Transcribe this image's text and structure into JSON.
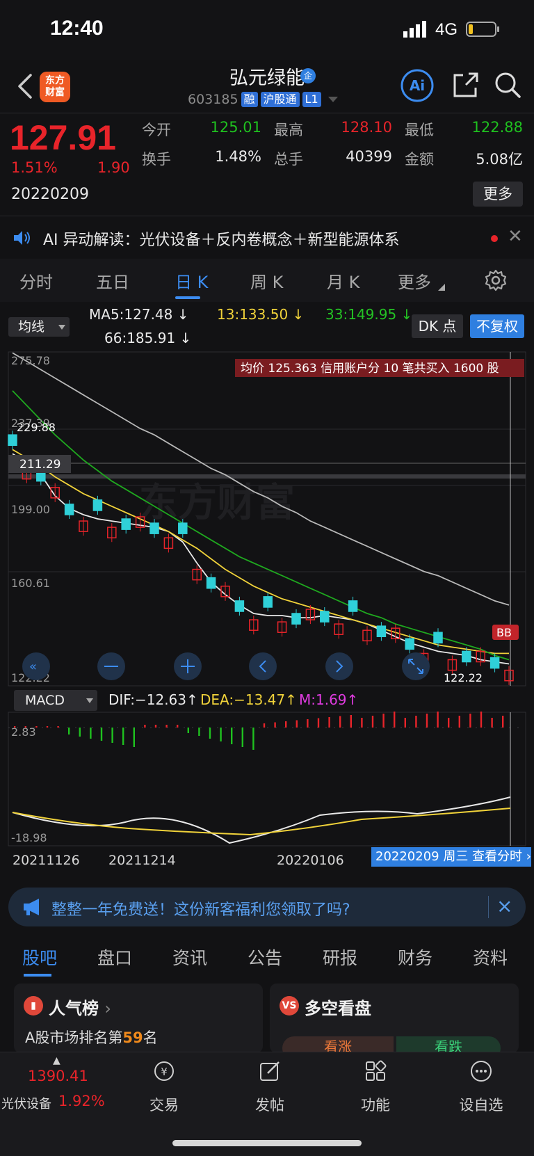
{
  "status_bar": {
    "time": "12:40",
    "network": "4G"
  },
  "header": {
    "logo_text": "东方\n财富",
    "stock_name": "弘元绿能",
    "corp_tag": "企",
    "code": "603185",
    "badges": [
      "融",
      "沪股通",
      "L1"
    ],
    "ai_label": "Ai"
  },
  "quote": {
    "price": "127.91",
    "change_pct": "1.51%",
    "change_abs": "1.90",
    "date": "20220209",
    "open_label": "今开",
    "open": "125.01",
    "high_label": "最高",
    "high": "128.10",
    "low_label": "最低",
    "low": "122.88",
    "turnover_label": "换手",
    "turnover": "1.48%",
    "volume_label": "总手",
    "volume": "40399",
    "amount_label": "金额",
    "amount": "5.08亿",
    "more_label": "更多"
  },
  "ai_bar": {
    "text": "AI 异动解读：光伏设备＋反内卷概念＋新型能源体系",
    "close": "✕"
  },
  "tabs": [
    "分时",
    "五日",
    "日 K",
    "周 K",
    "月 K",
    "更多"
  ],
  "ma": {
    "select_label": "均线",
    "ma5": "MA5:127.48",
    "ma13": "13:133.50",
    "ma33": "33:149.95",
    "ma66": "66:185.91",
    "dk_label": "DK 点",
    "fq_label": "不复权"
  },
  "kchart": {
    "info_banner": "均价 125.363 信用账户分 10 笔共买入 1600 股",
    "price_labels": [
      "275.78",
      "237.39",
      "199.00",
      "160.61",
      "122.22"
    ],
    "crosshair_price": "211.29",
    "high_marker": "229.88",
    "low_marker": "122.22",
    "bb_label": "BB"
  },
  "macd": {
    "select_label": "MACD",
    "dif": "DIF:−12.63",
    "dea": "DEA:−13.47",
    "m": "M:1.69",
    "top_label": "2.83",
    "bottom_label": "-18.98"
  },
  "date_axis": {
    "dates": [
      "20211126",
      "20211214",
      "20220106"
    ],
    "tip": "20220209 周三  查看分时"
  },
  "banner": {
    "text": "整整一年免费送！这份新客福利您领取了吗?"
  },
  "sub_tabs": [
    "股吧",
    "盘口",
    "资讯",
    "公告",
    "研报",
    "财务",
    "资料"
  ],
  "cards": {
    "popular_title": "人气榜",
    "rank_prefix": "A股市场排名第",
    "rank_num": "59",
    "rank_suffix": "名",
    "longshort_title": "多空看盘",
    "bull": "看涨",
    "bear": "看跌"
  },
  "bottom_nav": {
    "index_value": "1390.41",
    "index_name": "光伏设备",
    "index_pct": "1.92%",
    "items": [
      "交易",
      "发帖",
      "功能",
      "设自选"
    ]
  },
  "colors": {
    "up": "#e8242a",
    "down": "#1fc11f",
    "accent": "#3c8cf0",
    "candle_down": "#2fd0d8"
  },
  "chart_data": {
    "type": "candlestick",
    "ylim": [
      122.22,
      275.78
    ],
    "series": [
      {
        "name": "MA5",
        "values": [
          228,
          224,
          218,
          208,
          202,
          199,
          197,
          196,
          195,
          194,
          193,
          191,
          186,
          176,
          167,
          161,
          156,
          152,
          151,
          151,
          150,
          150,
          151,
          150,
          149,
          147,
          144,
          141,
          138,
          136,
          134,
          133,
          132,
          130,
          129,
          128
        ]
      },
      {
        "name": "MA13",
        "values": [
          230,
          226,
          222,
          217,
          213,
          209,
          206,
          203,
          200,
          197,
          194,
          191,
          187,
          183,
          178,
          173,
          169,
          165,
          162,
          159,
          157,
          155,
          153,
          151,
          149,
          147,
          145,
          143,
          141,
          139,
          137,
          136,
          135,
          134,
          133,
          133
        ]
      },
      {
        "name": "MA33",
        "values": [
          258,
          251,
          244,
          237,
          231,
          225,
          220,
          215,
          211,
          207,
          203,
          199,
          195,
          191,
          187,
          183,
          179,
          176,
          173,
          170,
          167,
          164,
          161,
          158,
          155,
          152,
          150,
          147,
          145,
          143,
          141,
          139,
          137,
          135,
          132,
          130
        ]
      },
      {
        "name": "MA66",
        "values": [
          276,
          272,
          268,
          264,
          260,
          256,
          252,
          248,
          244,
          240,
          237,
          233,
          229,
          225,
          221,
          218,
          214,
          210,
          207,
          203,
          200,
          196,
          193,
          190,
          187,
          184,
          181,
          178,
          175,
          172,
          170,
          167,
          164,
          161,
          158,
          156
        ]
      }
    ]
  }
}
